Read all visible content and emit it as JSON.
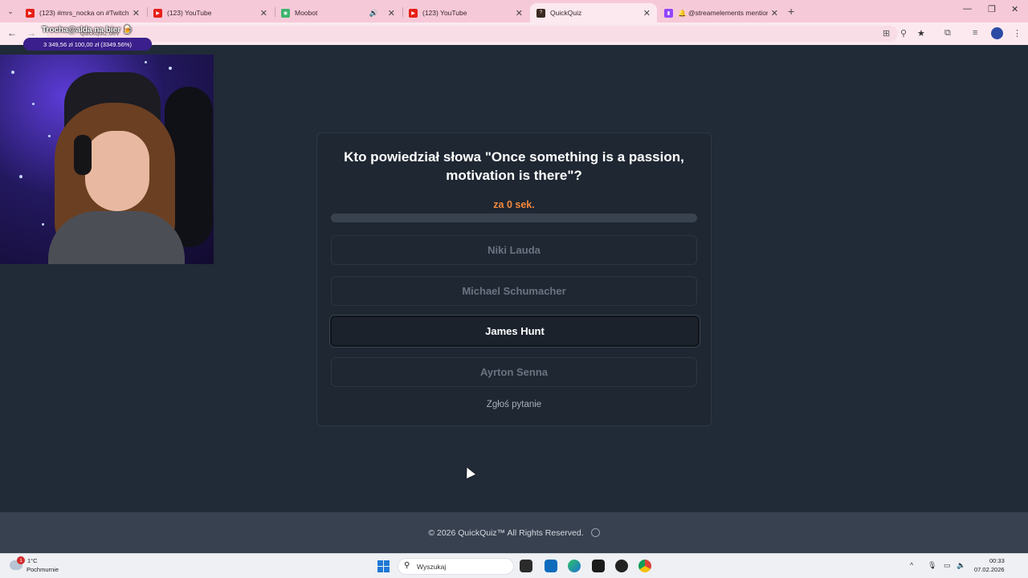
{
  "browser": {
    "tabs": [
      {
        "title": "(123) #mrs_nocka on #Twitch |",
        "icon": "youtube-icon",
        "color": "#e62117"
      },
      {
        "title": "(123) YouTube",
        "icon": "youtube-icon",
        "color": "#e62117"
      },
      {
        "title": "Moobot",
        "icon": "moobot-icon",
        "color": "#3db46d",
        "muted": true
      },
      {
        "title": "(123) YouTube",
        "icon": "youtube-icon",
        "color": "#e62117"
      },
      {
        "title": "QuickQuiz",
        "icon": "quickquiz-icon",
        "color": "#3a2a20",
        "active": true
      },
      {
        "title": "🔔 @streamelements mention",
        "icon": "twitch-icon",
        "color": "#9146ff"
      }
    ],
    "url": "quickquiz.dev"
  },
  "donation": {
    "title": "Trocha@alda na bier 🍺",
    "amounts": "3 349,56 zł  100,00 zł (3349.56%)"
  },
  "quiz": {
    "question": "Kto powiedział słowa \"Once something is a passion, motivation is there\"?",
    "timer": "za 0 sek.",
    "progress": 0,
    "answers": [
      {
        "label": "Niki Lauda",
        "selected": false
      },
      {
        "label": "Michael Schumacher",
        "selected": false
      },
      {
        "label": "James Hunt",
        "selected": true
      },
      {
        "label": "Ayrton Senna",
        "selected": false
      }
    ],
    "report_label": "Zgłoś pytanie",
    "accent": "#f5883c"
  },
  "footer": {
    "text": "© 2026  QuickQuiz™ All Rights Reserved."
  },
  "taskbar": {
    "weather_temp": "1°C",
    "weather_desc": "Pochmurnie",
    "weather_badge": "1",
    "search_placeholder": "Wyszukaj",
    "time": "00:33",
    "date": "07.02.2026"
  }
}
